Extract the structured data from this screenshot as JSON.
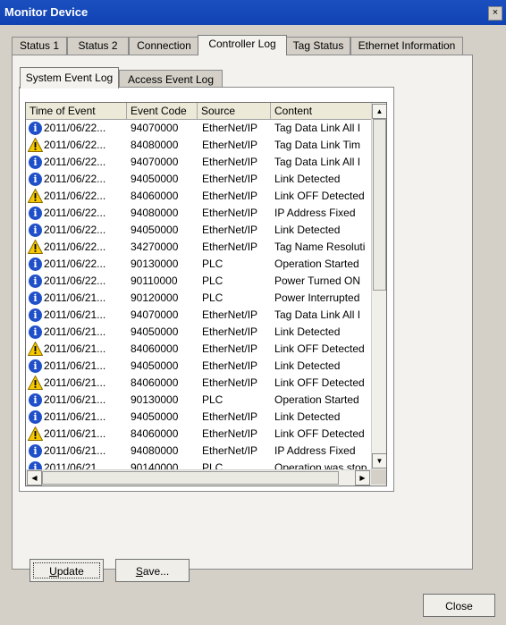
{
  "window": {
    "title": "Monitor Device",
    "close_glyph": "×"
  },
  "tabs": [
    {
      "label": "Status 1"
    },
    {
      "label": "Status 2"
    },
    {
      "label": "Connection"
    },
    {
      "label": "Controller Log",
      "active": true
    },
    {
      "label": "Tag Status"
    },
    {
      "label": "Ethernet Information"
    }
  ],
  "subtabs": [
    {
      "label": "System Event Log",
      "active": true
    },
    {
      "label": "Access Event Log"
    }
  ],
  "table": {
    "columns": [
      "Time of Event",
      "Event Code",
      "Source",
      "Content"
    ],
    "rows": [
      {
        "icon": "info-icon",
        "time": "2011/06/22...",
        "code": "94070000",
        "source": "EtherNet/IP",
        "content": "Tag Data Link All I"
      },
      {
        "icon": "warning-icon",
        "time": "2011/06/22...",
        "code": "84080000",
        "source": "EtherNet/IP",
        "content": "Tag Data Link Tim"
      },
      {
        "icon": "info-icon",
        "time": "2011/06/22...",
        "code": "94070000",
        "source": "EtherNet/IP",
        "content": "Tag Data Link All I"
      },
      {
        "icon": "info-icon",
        "time": "2011/06/22...",
        "code": "94050000",
        "source": "EtherNet/IP",
        "content": "Link Detected"
      },
      {
        "icon": "warning-icon",
        "time": "2011/06/22...",
        "code": "84060000",
        "source": "EtherNet/IP",
        "content": "Link OFF Detected"
      },
      {
        "icon": "info-icon",
        "time": "2011/06/22...",
        "code": "94080000",
        "source": "EtherNet/IP",
        "content": "IP Address Fixed"
      },
      {
        "icon": "info-icon",
        "time": "2011/06/22...",
        "code": "94050000",
        "source": "EtherNet/IP",
        "content": "Link Detected"
      },
      {
        "icon": "warning-icon",
        "time": "2011/06/22...",
        "code": "34270000",
        "source": "EtherNet/IP",
        "content": "Tag Name Resoluti"
      },
      {
        "icon": "info-icon",
        "time": "2011/06/22...",
        "code": "90130000",
        "source": "PLC",
        "content": "Operation Started"
      },
      {
        "icon": "info-icon",
        "time": "2011/06/22...",
        "code": "90110000",
        "source": "PLC",
        "content": "Power Turned ON"
      },
      {
        "icon": "info-icon",
        "time": "2011/06/21...",
        "code": "90120000",
        "source": "PLC",
        "content": "Power Interrupted"
      },
      {
        "icon": "info-icon",
        "time": "2011/06/21...",
        "code": "94070000",
        "source": "EtherNet/IP",
        "content": "Tag Data Link All I"
      },
      {
        "icon": "info-icon",
        "time": "2011/06/21...",
        "code": "94050000",
        "source": "EtherNet/IP",
        "content": "Link Detected"
      },
      {
        "icon": "warning-icon",
        "time": "2011/06/21...",
        "code": "84060000",
        "source": "EtherNet/IP",
        "content": "Link OFF Detected"
      },
      {
        "icon": "info-icon",
        "time": "2011/06/21...",
        "code": "94050000",
        "source": "EtherNet/IP",
        "content": "Link Detected"
      },
      {
        "icon": "warning-icon",
        "time": "2011/06/21...",
        "code": "84060000",
        "source": "EtherNet/IP",
        "content": "Link OFF Detected"
      },
      {
        "icon": "info-icon",
        "time": "2011/06/21...",
        "code": "90130000",
        "source": "PLC",
        "content": "Operation Started"
      },
      {
        "icon": "info-icon",
        "time": "2011/06/21...",
        "code": "94050000",
        "source": "EtherNet/IP",
        "content": "Link Detected"
      },
      {
        "icon": "warning-icon",
        "time": "2011/06/21...",
        "code": "84060000",
        "source": "EtherNet/IP",
        "content": "Link OFF Detected"
      },
      {
        "icon": "info-icon",
        "time": "2011/06/21...",
        "code": "94080000",
        "source": "EtherNet/IP",
        "content": "IP Address Fixed"
      },
      {
        "icon": "info-icon",
        "time": "2011/06/21...",
        "code": "90140000",
        "source": "PLC",
        "content": "Operation was stop"
      }
    ]
  },
  "scroll": {
    "up_glyph": "▲",
    "down_glyph": "▼",
    "left_glyph": "◀",
    "right_glyph": "▶"
  },
  "buttons": {
    "update": {
      "accel": "U",
      "rest": "pdate"
    },
    "save": {
      "accel": "S",
      "rest": "ave..."
    },
    "close": "Close"
  },
  "colors": {
    "title_bar": "#1042b4",
    "info_icon": "#1f4fc9",
    "warning_icon": "#f5c800"
  }
}
